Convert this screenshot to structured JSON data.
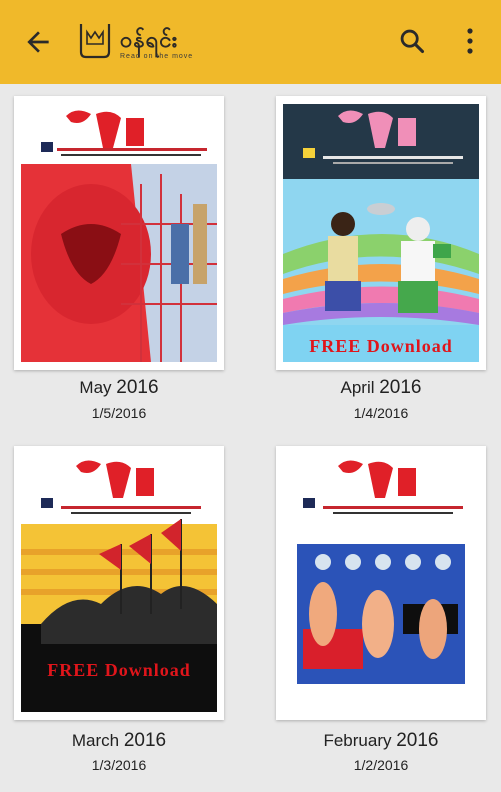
{
  "appbar": {
    "brand": "ဝန်ရင်း",
    "tagline": "Read on the move",
    "icons": {
      "back": "arrow-back-icon",
      "search": "search-icon",
      "more": "more-vert-icon"
    }
  },
  "colors": {
    "appbar": "#f0b92a",
    "background": "#e9e9e9",
    "free_text": "#e0151b"
  },
  "magazines": [
    {
      "month": "May",
      "year": "2016",
      "date": "1/5/2016",
      "free_label": ""
    },
    {
      "month": "April",
      "year": "2016",
      "date": "1/4/2016",
      "free_label": "FREE Download"
    },
    {
      "month": "March",
      "year": "2016",
      "date": "1/3/2016",
      "free_label": "FREE Download"
    },
    {
      "month": "February",
      "year": "2016",
      "date": "1/2/2016",
      "free_label": ""
    }
  ]
}
